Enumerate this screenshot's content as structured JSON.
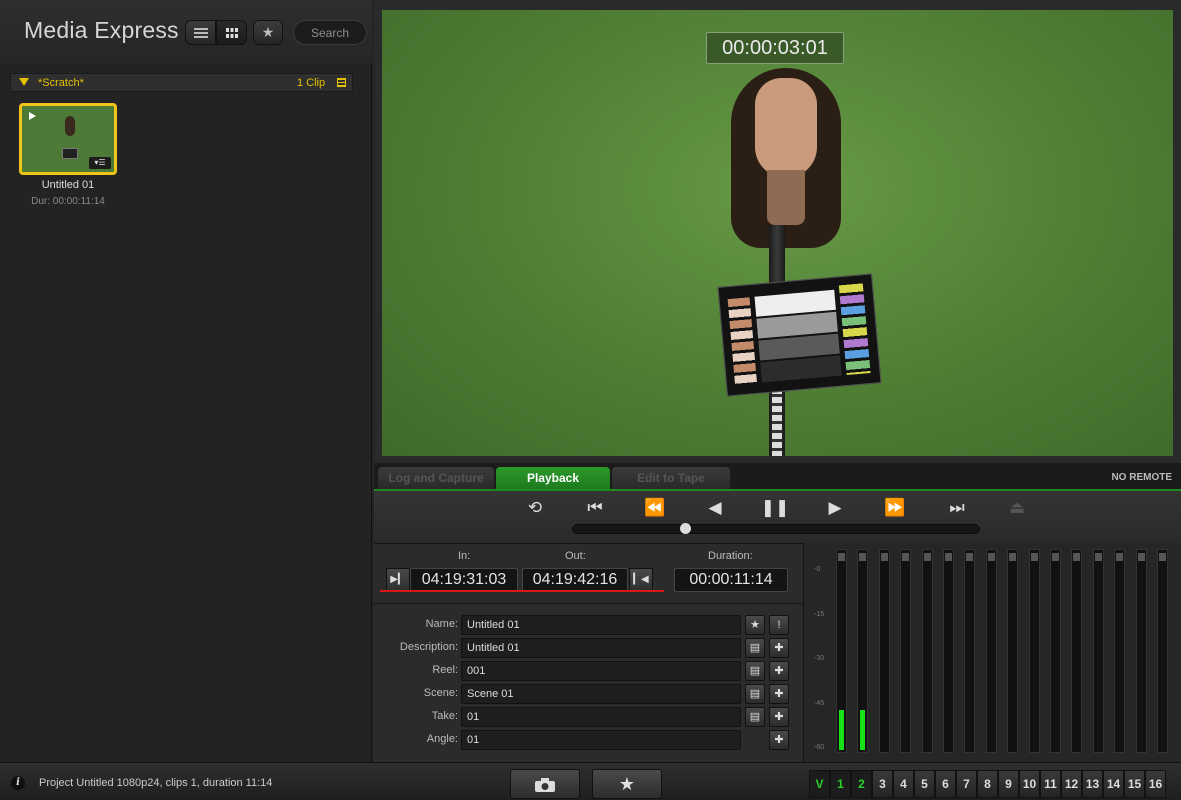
{
  "app": {
    "title": "Media Express"
  },
  "toolbar": {
    "search_label": "Search"
  },
  "bin": {
    "name": "*Scratch*",
    "count": "1 Clip"
  },
  "clip": {
    "name": "Untitled 01",
    "duration": "Dur: 00:00:11:14"
  },
  "viewer": {
    "timecode": "00:00:03:01"
  },
  "tabs": {
    "log": "Log and Capture",
    "playback": "Playback",
    "edit": "Edit to Tape",
    "remote": "NO REMOTE"
  },
  "transport": {
    "loop": "⟲",
    "first": "⏮",
    "rewind": "⏪",
    "back": "◀",
    "pause": "❚❚",
    "play": "▶",
    "forward": "⏩",
    "last": "⏭",
    "eject": "⏏"
  },
  "scrubber": {
    "position": 0.27
  },
  "inout": {
    "in_label": "In:",
    "out_label": "Out:",
    "duration_label": "Duration:",
    "in": "04:19:31:03",
    "out": "04:19:42:16",
    "duration": "00:00:11:14"
  },
  "metadata": [
    {
      "label": "Name:",
      "value": "Untitled 01"
    },
    {
      "label": "Description:",
      "value": "Untitled 01"
    },
    {
      "label": "Reel:",
      "value": "001"
    },
    {
      "label": "Scene:",
      "value": "Scene 01"
    },
    {
      "label": "Take:",
      "value": "01"
    },
    {
      "label": "Angle:",
      "value": "01"
    }
  ],
  "meters": {
    "scale": [
      "-0",
      "-15",
      "-30",
      "-45",
      "-60"
    ],
    "levels": [
      0.2,
      0.2,
      0,
      0,
      0,
      0,
      0,
      0,
      0,
      0,
      0,
      0,
      0,
      0,
      0,
      0
    ]
  },
  "status": {
    "text": "Project Untitled  1080p24, clips 1, duration 11:14"
  },
  "channels": [
    "V",
    "1",
    "2",
    "3",
    "4",
    "5",
    "6",
    "7",
    "8",
    "9",
    "10",
    "11",
    "12",
    "13",
    "14",
    "15",
    "16"
  ],
  "colors": {
    "accent_yellow": "#f0c419",
    "accent_green": "#1e8a1e",
    "marker_red": "#d81818",
    "level_green": "#18e018"
  }
}
